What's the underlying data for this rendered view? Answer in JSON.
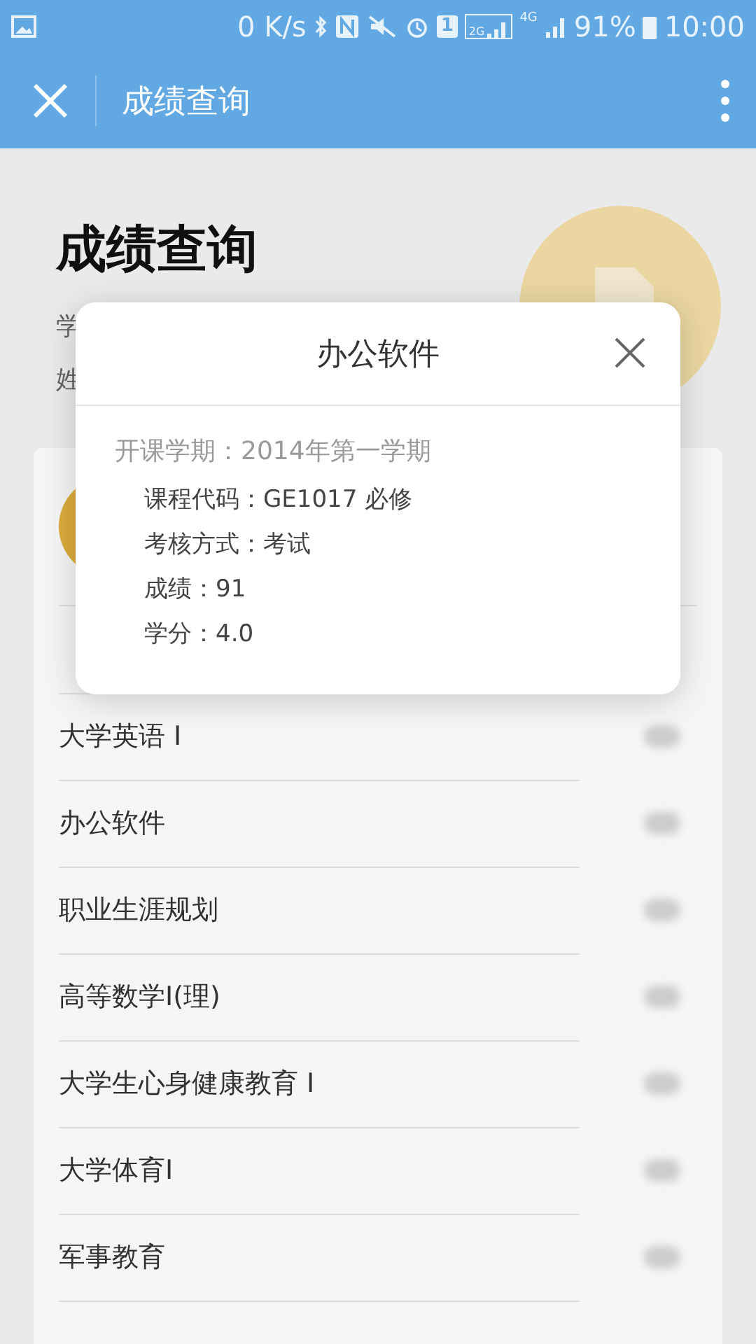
{
  "status_bar": {
    "speed": "0 K/s",
    "sim": "1",
    "network_2g": "2G",
    "network_4g": "4G",
    "battery": "91%",
    "time": "10:00"
  },
  "nav_bar": {
    "title": "成绩查询"
  },
  "header": {
    "title": "成绩查询",
    "lines": [
      "学",
      "姓"
    ]
  },
  "courses": [
    {
      "name": "大学英语 I"
    },
    {
      "name": "办公软件"
    },
    {
      "name": "职业生涯规划"
    },
    {
      "name": "高等数学I(理)"
    },
    {
      "name": "大学生心身健康教育 I"
    },
    {
      "name": "大学体育I"
    },
    {
      "name": "军事教育"
    }
  ],
  "dialog": {
    "title": "办公软件",
    "term": "开课学期：2014年第一学期",
    "details": [
      "课程代码：GE1017 必修",
      "考核方式：考试",
      "成绩：91",
      "学分：4.0"
    ]
  }
}
